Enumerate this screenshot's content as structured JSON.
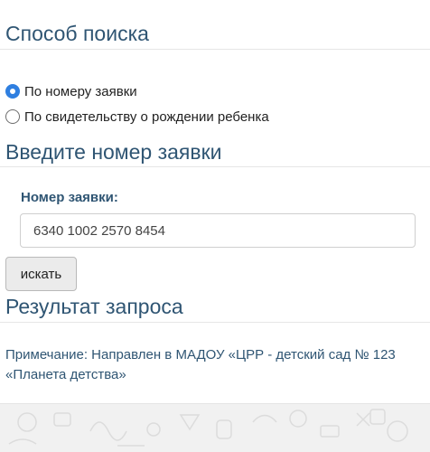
{
  "search_method": {
    "title": "Способ поиска",
    "options": [
      {
        "label": "По номеру заявки",
        "checked": true
      },
      {
        "label": "По свидетельству о рождении ребенка",
        "checked": false
      }
    ]
  },
  "application_number": {
    "title": "Введите номер заявки",
    "field_label": "Номер заявки:",
    "value": "6340 1002 2570 8454",
    "search_button_label": "искать"
  },
  "result": {
    "title": "Результат запроса",
    "note_line1": "Примечание: Направлен в МАДОУ «ЦРР - детский сад № 123",
    "note_line2": "«Планета детства»"
  },
  "colors": {
    "heading": "#2f5573",
    "radio_accent": "#2f7fe0",
    "button_bg": "#ebebeb"
  }
}
